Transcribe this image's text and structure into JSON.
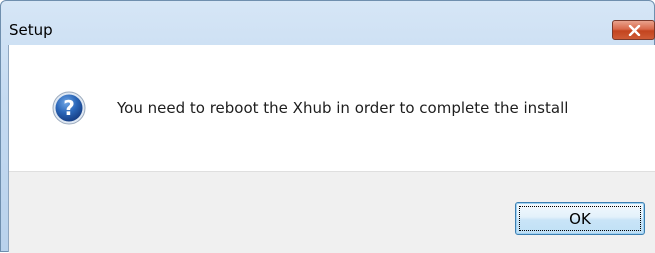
{
  "dialog": {
    "title": "Setup",
    "message": "You need to reboot the Xhub in order to complete the install",
    "icon": "question-icon",
    "ok_label": "OK",
    "close_icon": "close-icon"
  },
  "colors": {
    "title_bar": "#c4daf1",
    "close_button": "#c3441f",
    "icon_blue": "#1f5fae",
    "footer": "#f0f0f0"
  }
}
